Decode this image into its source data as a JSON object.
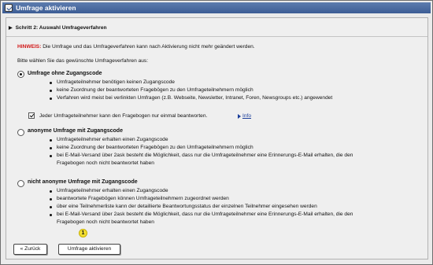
{
  "window": {
    "title": "Umfrage aktivieren"
  },
  "step": {
    "label": "Schritt 2: Auswahl Umfrageverfahren"
  },
  "notice": {
    "highlight": "HINWEIS:",
    "text": " Die Umfrage und das Umfrageverfahren kann nach Aktivierung nicht mehr geändert werden."
  },
  "prompt": "Bitte wählen Sie das gewünschte Umfrageverfahren aus:",
  "options": [
    {
      "title": "Umfrage ohne Zugangscode",
      "selected": true,
      "bullets": [
        "Umfrageteilnehmer benötigen keinen Zugangscode",
        "keine Zuordnung der beantworteten Fragebögen zu den Umfrageteilnehmern möglich",
        "Verfahren wird meist bei verlinkten Umfragen (z.B. Webseite, Newsletter, Intranet, Foren, Newsgroups etc.) angewendet"
      ],
      "checkbox": {
        "label": "Jeder Umfrageteilnehmer kann den Fragebogen nur einmal beantworten.",
        "checked": true,
        "info_link": "Info"
      }
    },
    {
      "title": "anonyme Umfrage mit Zugangscode",
      "selected": false,
      "bullets": [
        "Umfrageteilnehmer erhalten einen Zugangscode",
        "keine Zuordnung der beantworteten Fragebögen zu den Umfrageteilnehmern möglich",
        "bei E-Mail-Versand über 2ask besteht die Möglichkeit, dass nur die Umfrageteilnehmer eine Erinnerungs-E-Mail erhalten, die den",
        "Fragebogen noch nicht beantwortet haben"
      ]
    },
    {
      "title": "nicht anonyme Umfrage mit Zugangscode",
      "selected": false,
      "bullets": [
        "Umfrageteilnehmer erhalten einen Zugangscode",
        "beantwortete Fragebögen können Umfrageteilnehmern zugeordnet werden",
        "über eine Teilnehmerliste kann der detaillierte Beantwortungsstatus der einzelnen Teilnehmer eingesehen werden",
        "bei E-Mail-Versand über 2ask besteht die Möglichkeit, dass nur die Umfrageteilnehmer eine Erinnerungs-E-Mail erhalten, die den",
        "Fragebogen noch nicht beantwortet haben"
      ]
    }
  ],
  "buttons": {
    "back": "« Zurück",
    "activate": "Umfrage aktivieren"
  },
  "marker": "1",
  "colors": {
    "titlebar": "#3d5d95",
    "hinweis": "#d11818",
    "marker": "#f3df33"
  }
}
